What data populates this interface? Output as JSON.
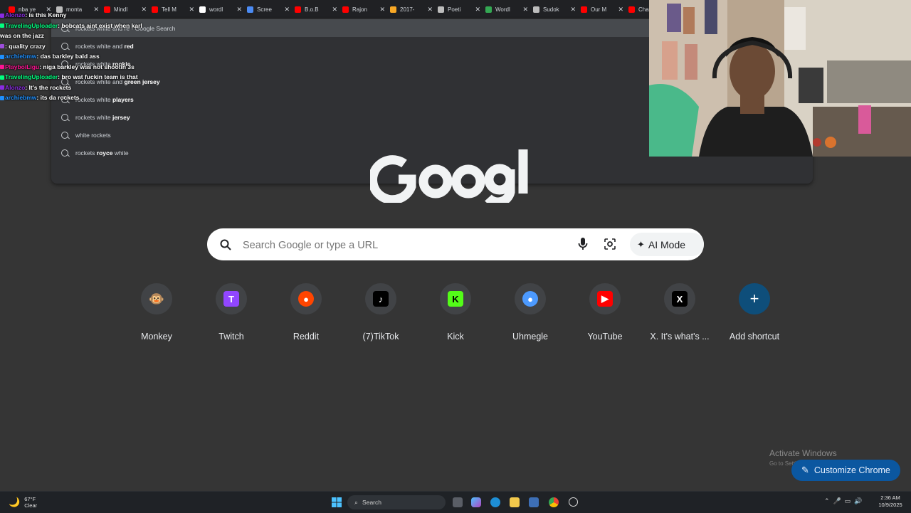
{
  "tabs": [
    {
      "label": "nba ye",
      "color": "#ff0000"
    },
    {
      "label": "monta",
      "color": "#bdbdbd"
    },
    {
      "label": "Mindl",
      "color": "#ff0000"
    },
    {
      "label": "Tell M",
      "color": "#ff0000"
    },
    {
      "label": "wordl",
      "color": "#ffffff"
    },
    {
      "label": "Scree",
      "color": "#4b8bf4"
    },
    {
      "label": "B.o.B",
      "color": "#ff0000"
    },
    {
      "label": "Rajon",
      "color": "#ff0000"
    },
    {
      "label": "2017-",
      "color": "#f9a825"
    },
    {
      "label": "Poeti",
      "color": "#bdbdbd"
    },
    {
      "label": "Wordl",
      "color": "#34a853"
    },
    {
      "label": "Sudok",
      "color": "#bdbdbd"
    },
    {
      "label": "Our M",
      "color": "#ff0000"
    },
    {
      "label": "Chan",
      "color": "#ff0000"
    }
  ],
  "omnibox": {
    "typed": "rockets white and re",
    "suggestions": [
      {
        "pre": "rockets white and re",
        "bold": "",
        "post": " - Google Search"
      },
      {
        "pre": "rockets white and ",
        "bold": "red",
        "post": ""
      },
      {
        "pre": "rockets white ",
        "bold": "rookie",
        "post": ""
      },
      {
        "pre": "rockets white and ",
        "bold": "green jersey",
        "post": ""
      },
      {
        "pre": "rockets white ",
        "bold": "players",
        "post": ""
      },
      {
        "pre": "rockets white ",
        "bold": "jersey",
        "post": ""
      },
      {
        "pre": "white rockets",
        "bold": "",
        "post": ""
      },
      {
        "pre": "rockets ",
        "bold": "royce",
        "post": " white"
      }
    ]
  },
  "search": {
    "placeholder": "Search Google or type a URL",
    "ai_mode_label": "AI Mode"
  },
  "shortcuts": [
    {
      "label": "Monkey",
      "icon": "🐵",
      "bg": "#414346",
      "fg": "#ffffff"
    },
    {
      "label": "Twitch",
      "icon": "T",
      "bg": "#9146ff",
      "fg": "#ffffff"
    },
    {
      "label": "Reddit",
      "icon": "●",
      "bg": "#ff4500",
      "fg": "#ffffff"
    },
    {
      "label": "(7)TikTok",
      "icon": "♪",
      "bg": "#000000",
      "fg": "#ffffff"
    },
    {
      "label": "Kick",
      "icon": "K",
      "bg": "#53fc18",
      "fg": "#000000"
    },
    {
      "label": "Uhmegle",
      "icon": "●",
      "bg": "#4c9aff",
      "fg": "#ffffff"
    },
    {
      "label": "YouTube",
      "icon": "▶",
      "bg": "#ff0000",
      "fg": "#ffffff"
    },
    {
      "label": "X. It's what's ...",
      "icon": "X",
      "bg": "#000000",
      "fg": "#ffffff"
    },
    {
      "label": "Add shortcut",
      "icon": "+",
      "bg": "#0e4e7a",
      "fg": "#ffffff"
    }
  ],
  "chat": [
    {
      "user": "Alonzo",
      "color": "#8a2be2",
      "text": "is this Kenny"
    },
    {
      "user": "TravelingUploader",
      "color": "#00ff7f",
      "text": "bobcats aint exist when karl was on the jazz"
    },
    {
      "user": "",
      "color": "#9d4edd",
      "text": "quality crazy"
    },
    {
      "user": "archiebmw",
      "color": "#1e90ff",
      "text": "das barkley bald ass"
    },
    {
      "user": "PlayboiLigu",
      "color": "#ff1493",
      "text": "niga barkley was not shootin 3s"
    },
    {
      "user": "TravelingUploader",
      "color": "#00ff7f",
      "text": "bro wat fuckin team is that"
    },
    {
      "user": "Alonzo",
      "color": "#8a2be2",
      "text": "It's the rockets"
    },
    {
      "user": "archiebmw",
      "color": "#1e90ff",
      "text": "its da rockets"
    }
  ],
  "watermark": {
    "title": "Activate Windows",
    "subtitle": "Go to Settings to activate Windows."
  },
  "customize_label": "Customize Chrome",
  "taskbar": {
    "temp": "67°F",
    "condition": "Clear",
    "search_label": "Search",
    "time": "2:36 AM",
    "date": "10/9/2025"
  }
}
